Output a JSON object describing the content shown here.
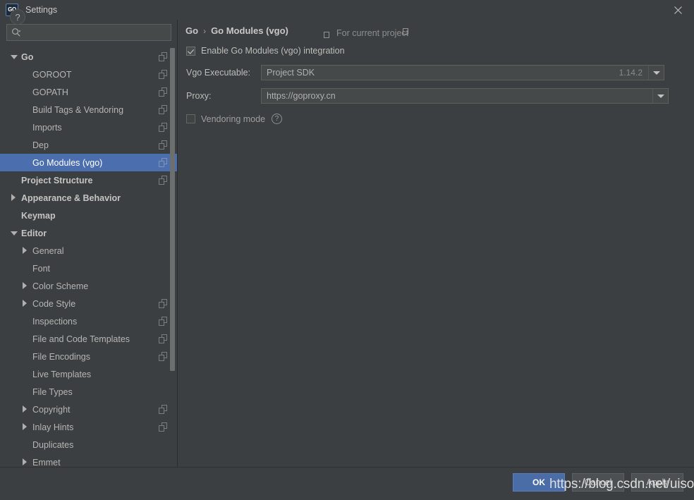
{
  "window": {
    "title": "Settings",
    "app_icon": "go-logo-icon",
    "close_icon": "close-icon"
  },
  "search": {
    "icon": "search-icon",
    "value": "",
    "placeholder": ""
  },
  "sidebar": {
    "scroll_icon": "vertical-scrollbar",
    "items": [
      {
        "label": "Go",
        "indent": 0,
        "arrow": "down",
        "bold": true,
        "selected": false,
        "copy": true
      },
      {
        "label": "GOROOT",
        "indent": 1,
        "arrow": "none",
        "bold": false,
        "selected": false,
        "copy": true
      },
      {
        "label": "GOPATH",
        "indent": 1,
        "arrow": "none",
        "bold": false,
        "selected": false,
        "copy": true
      },
      {
        "label": "Build Tags & Vendoring",
        "indent": 1,
        "arrow": "none",
        "bold": false,
        "selected": false,
        "copy": true
      },
      {
        "label": "Imports",
        "indent": 1,
        "arrow": "none",
        "bold": false,
        "selected": false,
        "copy": true
      },
      {
        "label": "Dep",
        "indent": 1,
        "arrow": "none",
        "bold": false,
        "selected": false,
        "copy": true
      },
      {
        "label": "Go Modules (vgo)",
        "indent": 1,
        "arrow": "none",
        "bold": false,
        "selected": true,
        "copy": true
      },
      {
        "label": "Project Structure",
        "indent": 0,
        "arrow": "none",
        "bold": true,
        "selected": false,
        "copy": true
      },
      {
        "label": "Appearance & Behavior",
        "indent": 0,
        "arrow": "right",
        "bold": true,
        "selected": false,
        "copy": false
      },
      {
        "label": "Keymap",
        "indent": 0,
        "arrow": "none",
        "bold": true,
        "selected": false,
        "copy": false
      },
      {
        "label": "Editor",
        "indent": 0,
        "arrow": "down",
        "bold": true,
        "selected": false,
        "copy": false
      },
      {
        "label": "General",
        "indent": 1,
        "arrow": "right",
        "bold": false,
        "selected": false,
        "copy": false
      },
      {
        "label": "Font",
        "indent": 1,
        "arrow": "none",
        "bold": false,
        "selected": false,
        "copy": false
      },
      {
        "label": "Color Scheme",
        "indent": 1,
        "arrow": "right",
        "bold": false,
        "selected": false,
        "copy": false
      },
      {
        "label": "Code Style",
        "indent": 1,
        "arrow": "right",
        "bold": false,
        "selected": false,
        "copy": true
      },
      {
        "label": "Inspections",
        "indent": 1,
        "arrow": "none",
        "bold": false,
        "selected": false,
        "copy": true
      },
      {
        "label": "File and Code Templates",
        "indent": 1,
        "arrow": "none",
        "bold": false,
        "selected": false,
        "copy": true
      },
      {
        "label": "File Encodings",
        "indent": 1,
        "arrow": "none",
        "bold": false,
        "selected": false,
        "copy": true
      },
      {
        "label": "Live Templates",
        "indent": 1,
        "arrow": "none",
        "bold": false,
        "selected": false,
        "copy": false
      },
      {
        "label": "File Types",
        "indent": 1,
        "arrow": "none",
        "bold": false,
        "selected": false,
        "copy": false
      },
      {
        "label": "Copyright",
        "indent": 1,
        "arrow": "right",
        "bold": false,
        "selected": false,
        "copy": true
      },
      {
        "label": "Inlay Hints",
        "indent": 1,
        "arrow": "right",
        "bold": false,
        "selected": false,
        "copy": true
      },
      {
        "label": "Duplicates",
        "indent": 1,
        "arrow": "none",
        "bold": false,
        "selected": false,
        "copy": false
      },
      {
        "label": "Emmet",
        "indent": 1,
        "arrow": "right",
        "bold": false,
        "selected": false,
        "copy": false
      }
    ]
  },
  "content": {
    "breadcrumb": {
      "root": "Go",
      "separator": "›",
      "current": "Go Modules (vgo)"
    },
    "for_current_project": {
      "icon": "copy-icon",
      "label": "For current project"
    },
    "enable_modules": {
      "label": "Enable Go Modules (vgo) integration",
      "checked": true
    },
    "vgo_executable": {
      "label": "Vgo Executable:",
      "value": "Project SDK",
      "version": "1.14.2",
      "dropdown_icon": "chevron-down-icon",
      "browse_label": "...",
      "browse_name": "browse-button"
    },
    "proxy": {
      "label": "Proxy:",
      "value": "https://goproxy.cn",
      "dropdown_icon": "chevron-down-icon",
      "help_icon": "help-circle-icon",
      "help_glyph": "?"
    },
    "vendoring": {
      "label": "Vendoring mode",
      "checked": false,
      "help_icon": "help-circle-icon",
      "help_glyph": "?"
    }
  },
  "footer": {
    "help_glyph": "?",
    "ok_label": "OK",
    "cancel_label": "Cancel",
    "apply_label": "Apply"
  },
  "overlay": {
    "watermark": "https://blog.csdn.net/uisoul"
  },
  "colors": {
    "background": "#3c3f41",
    "selection": "#4b6eaf",
    "accent_button": "#4a6da7",
    "field": "#45494a",
    "text": "#bbbbbb"
  }
}
